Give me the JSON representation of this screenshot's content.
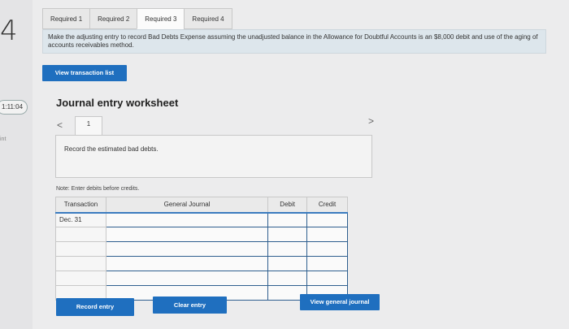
{
  "gutter": {
    "number": "4",
    "timer": "1:11:04",
    "label": "int"
  },
  "tabs": [
    {
      "label": "Required 1"
    },
    {
      "label": "Required 2"
    },
    {
      "label": "Required 3"
    },
    {
      "label": "Required 4"
    }
  ],
  "instruction": "Make the adjusting entry to record Bad Debts Expense assuming the unadjusted balance in the Allowance for Doubtful Accounts is an $8,000 debit and use of the aging of accounts receivables method.",
  "buttons": {
    "view_transaction_list": "View transaction list",
    "record_entry": "Record entry",
    "clear_entry": "Clear entry",
    "view_general_journal": "View general journal"
  },
  "worksheet": {
    "title": "Journal entry worksheet",
    "page": "1",
    "prev": "<",
    "next": ">",
    "description": "Record the estimated bad debts.",
    "note": "Note: Enter debits before credits."
  },
  "table": {
    "headers": [
      "Transaction",
      "General Journal",
      "Debit",
      "Credit"
    ],
    "rows": [
      {
        "transaction": "Dec. 31"
      },
      {
        "transaction": ""
      },
      {
        "transaction": ""
      },
      {
        "transaction": ""
      },
      {
        "transaction": ""
      },
      {
        "transaction": ""
      }
    ]
  }
}
